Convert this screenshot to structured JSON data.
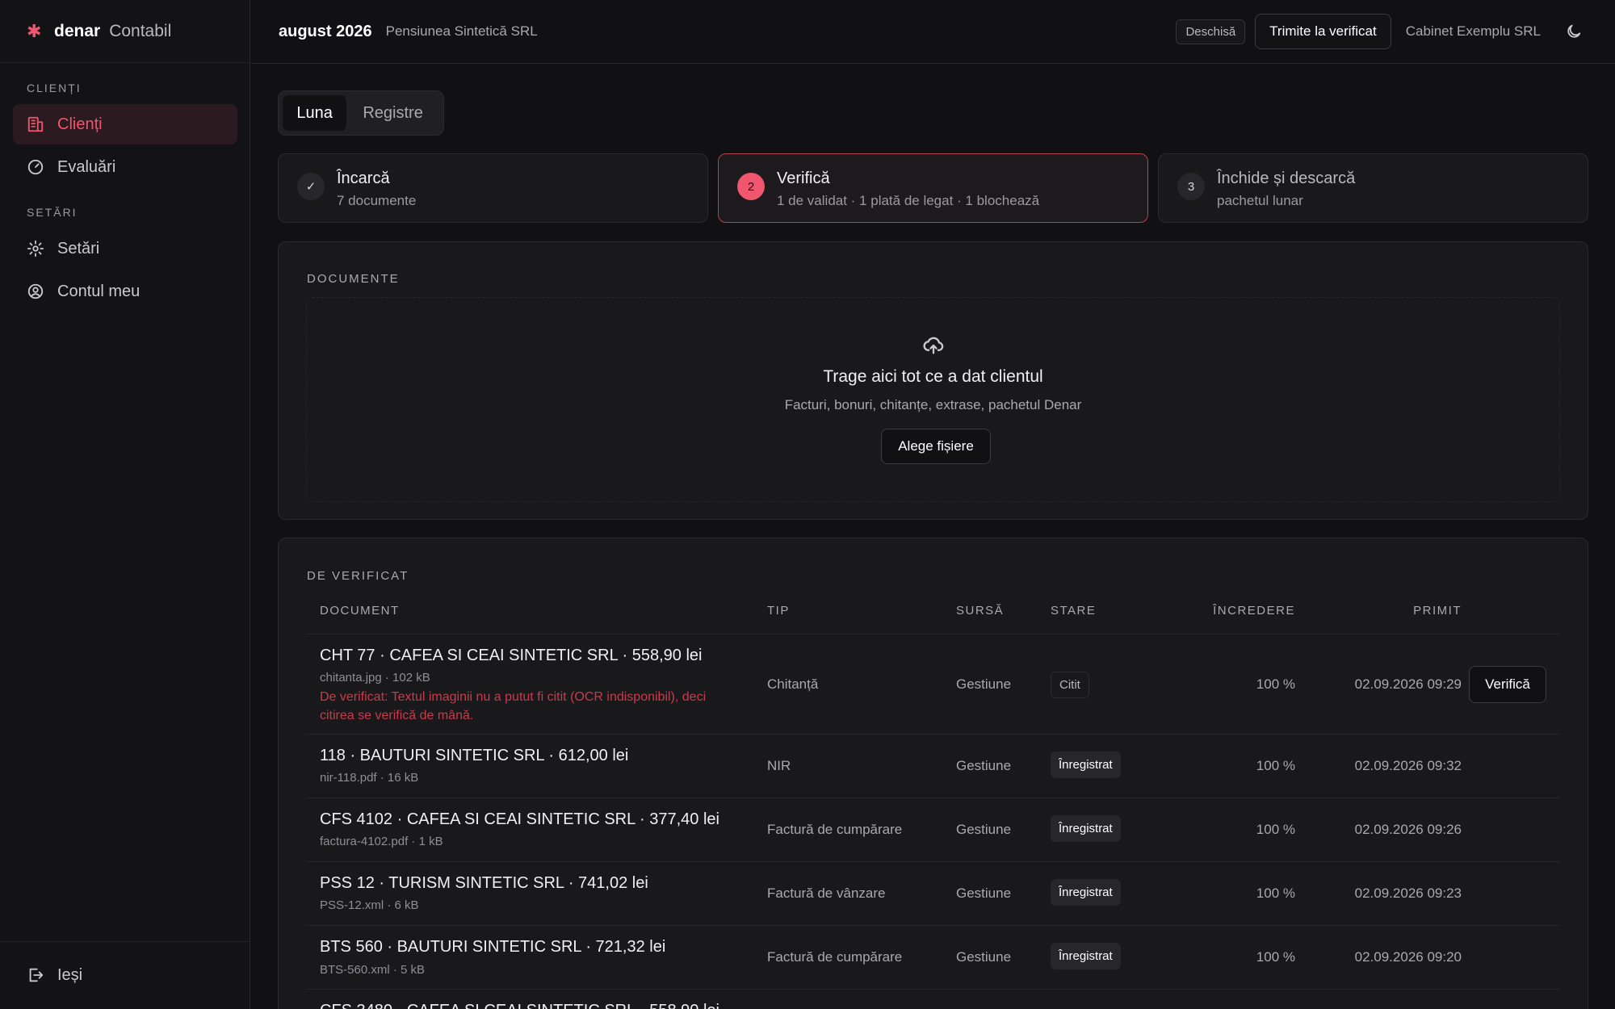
{
  "brand": {
    "mark": "✱",
    "name": "denar",
    "sub": "Contabil"
  },
  "sidebar": {
    "sections": [
      {
        "label": "CLIENȚI"
      },
      {
        "label": "SETĂRI"
      }
    ],
    "items": [
      {
        "label": "Clienți",
        "icon": "building-icon",
        "active": true
      },
      {
        "label": "Evaluări",
        "icon": "gauge-icon"
      },
      {
        "label": "Setări",
        "icon": "gear-icon"
      },
      {
        "label": "Contul meu",
        "icon": "user-circle-icon"
      }
    ],
    "logout": "Ieși"
  },
  "header": {
    "period": "august 2026",
    "company": "Pensiunea Sintetică SRL",
    "status_badge": "Deschisă",
    "send_button": "Trimite la verificat",
    "cabinet": "Cabinet Exemplu SRL"
  },
  "tabs": [
    {
      "label": "Luna"
    },
    {
      "label": "Registre"
    }
  ],
  "steps": [
    {
      "marker": "✓",
      "title": "Încarcă",
      "sub": "7 documente"
    },
    {
      "marker": "2",
      "title": "Verifică",
      "sub": "1 de validat · 1 plată de legat · 1 blochează"
    },
    {
      "marker": "3",
      "title": "Închide și descarcă",
      "sub": "pachetul lunar"
    }
  ],
  "documents": {
    "title": "DOCUMENTE",
    "drop_title": "Trage aici tot ce a dat clientul",
    "drop_sub": "Facturi, bonuri, chitanțe, extrase, pachetul Denar",
    "choose_button": "Alege fișiere"
  },
  "review": {
    "title": "DE VERIFICAT",
    "columns": [
      "DOCUMENT",
      "TIP",
      "SURSĂ",
      "STARE",
      "ÎNCREDERE",
      "PRIMIT"
    ],
    "rows": [
      {
        "title": "CHT 77 · CAFEA SI CEAI SINTETIC SRL · 558,90 lei",
        "meta": "chitanta.jpg · 102 kB",
        "warning": "De verificat: Textul imaginii nu a putut fi citit (OCR indisponibil), deci citirea se verifică de mână.",
        "type": "Chitanță",
        "source": "Gestiune",
        "status": "Citit",
        "confidence": "100 %",
        "received": "02.09.2026 09:29",
        "action": "Verifică"
      },
      {
        "title": "118 · BAUTURI SINTETIC SRL · 612,00 lei",
        "meta": "nir-118.pdf · 16 kB",
        "type": "NIR",
        "source": "Gestiune",
        "status": "Înregistrat",
        "confidence": "100 %",
        "received": "02.09.2026 09:32"
      },
      {
        "title": "CFS 4102 · CAFEA SI CEAI SINTETIC SRL · 377,40 lei",
        "meta": "factura-4102.pdf · 1 kB",
        "type": "Factură de cumpărare",
        "source": "Gestiune",
        "status": "Înregistrat",
        "confidence": "100 %",
        "received": "02.09.2026 09:26"
      },
      {
        "title": "PSS 12 · TURISM SINTETIC SRL · 741,02 lei",
        "meta": "PSS-12.xml · 6 kB",
        "type": "Factură de vânzare",
        "source": "Gestiune",
        "status": "Înregistrat",
        "confidence": "100 %",
        "received": "02.09.2026 09:23"
      },
      {
        "title": "BTS 560 · BAUTURI SINTETIC SRL · 721,32 lei",
        "meta": "BTS-560.xml · 5 kB",
        "type": "Factură de cumpărare",
        "source": "Gestiune",
        "status": "Înregistrat",
        "confidence": "100 %",
        "received": "02.09.2026 09:20"
      },
      {
        "title": "CFS 3480 · CAFEA SI CEAI SINTETIC SRL · 558,90 lei"
      }
    ]
  }
}
